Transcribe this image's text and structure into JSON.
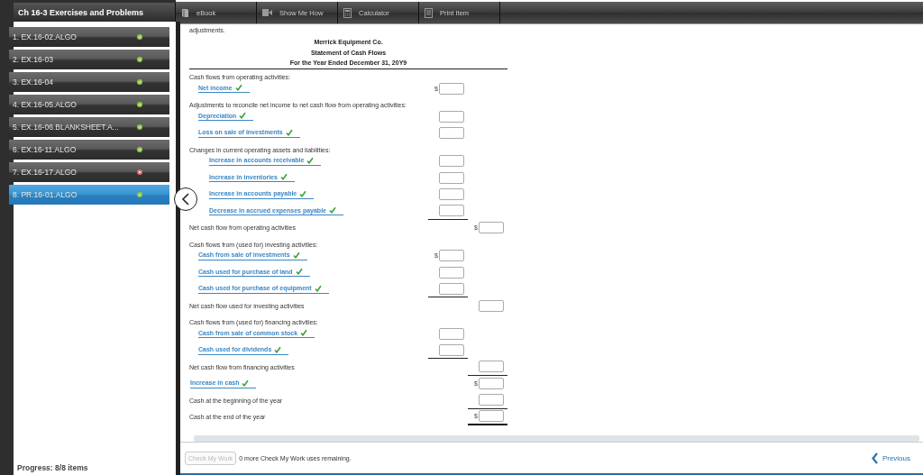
{
  "sidebar": {
    "title": "Ch 16-3 Exercises and Problems",
    "items": [
      {
        "label": "1. EX.16-02.ALGO",
        "correct": true,
        "selected": false
      },
      {
        "label": "2. EX.16-03",
        "correct": true,
        "selected": false
      },
      {
        "label": "3. EX.16-04",
        "correct": true,
        "selected": false
      },
      {
        "label": "4. EX.16-05.ALGO",
        "correct": true,
        "selected": false
      },
      {
        "label": "5. EX.16-06.BLANKSHEET.A...",
        "correct": true,
        "selected": false
      },
      {
        "label": "6. EX.16-11.ALGO",
        "correct": true,
        "selected": false
      },
      {
        "label": "7. EX.16-17.ALGO",
        "correct": false,
        "selected": false
      },
      {
        "label": "8. PR.16-01.ALGO",
        "correct": true,
        "selected": true
      }
    ],
    "progress": "Progress: 8/8 items"
  },
  "toolbar": {
    "tools": [
      {
        "label": "eBook",
        "kind": "book"
      },
      {
        "label": "Show Me How",
        "kind": "video"
      },
      {
        "label": "Calculator",
        "kind": "calculator"
      },
      {
        "label": "Print Item",
        "kind": "print"
      }
    ]
  },
  "problem": {
    "text": "adjustments.",
    "statement": {
      "company": "Merrick Equipment Co.",
      "title": "Statement of Cash Flows",
      "period": "For the Year Ended December 31, 20Y9",
      "rows": [
        {
          "kind": "heading",
          "label": "Cash flows from operating activities:"
        },
        {
          "kind": "item",
          "label": "Net income",
          "correct": true,
          "currency": "$"
        },
        {
          "kind": "heading",
          "label": "Adjustments to reconcile net income to net cash flow from operating activities:"
        },
        {
          "kind": "item",
          "label": "Depreciation",
          "correct": true
        },
        {
          "kind": "item",
          "label": "Loss on sale of investments",
          "correct": true
        },
        {
          "kind": "heading",
          "label": "Changes in current operating assets and liabilities:"
        },
        {
          "kind": "subitem",
          "label": "Increase in accounts receivable",
          "correct": true
        },
        {
          "kind": "subitem",
          "label": "Increase in inventories",
          "correct": true
        },
        {
          "kind": "subitem",
          "label": "Increase in accounts payable",
          "correct": true
        },
        {
          "kind": "subitem",
          "label": "Decrease in accrued expenses payable",
          "correct": true,
          "underlined": true
        },
        {
          "kind": "total",
          "label": "Net cash flow from operating activities",
          "currency": "$"
        },
        {
          "kind": "heading",
          "label": "Cash flows from (used for) investing activities:"
        },
        {
          "kind": "item",
          "label": "Cash from sale of investments",
          "correct": true,
          "currency": "$"
        },
        {
          "kind": "item",
          "label": "Cash used for purchase of land",
          "correct": true
        },
        {
          "kind": "item",
          "label": "Cash used for purchase of equipment",
          "correct": true,
          "underlined": true
        },
        {
          "kind": "total",
          "label": "Net cash flow used for investing activities"
        },
        {
          "kind": "heading",
          "label": "Cash flows from (used for) financing activities:"
        },
        {
          "kind": "item",
          "label": "Cash from sale of common stock",
          "correct": true
        },
        {
          "kind": "item",
          "label": "Cash used for dividends",
          "correct": true,
          "underlined": true
        },
        {
          "kind": "total",
          "label": "Net cash flow from financing activities",
          "underlined": true
        },
        {
          "kind": "answer_total",
          "label": "Increase in cash",
          "correct": true,
          "currency": "$"
        },
        {
          "kind": "total",
          "label": "Cash at the beginning of the year",
          "underlined": true
        },
        {
          "kind": "total",
          "label": "Cash at the end of the year",
          "currency": "$",
          "double_underlined": true
        }
      ]
    }
  },
  "footer": {
    "check_button": {
      "label": "Check My Work",
      "disabled": true
    },
    "remaining": "0 more Check My Work uses remaining.",
    "previous": "Previous"
  }
}
